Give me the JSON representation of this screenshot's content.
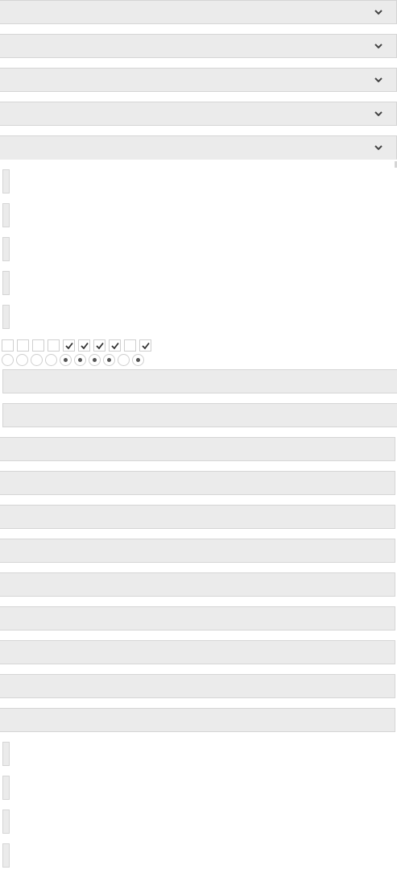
{
  "selects": [
    {
      "value": "",
      "expanded": false
    },
    {
      "value": "",
      "expanded": false
    },
    {
      "value": "",
      "expanded": false
    },
    {
      "value": "",
      "expanded": false
    },
    {
      "value": "",
      "expanded": true
    }
  ],
  "checkboxes": [
    false,
    false,
    false,
    false,
    true,
    true,
    true,
    true,
    false,
    true
  ],
  "radios": [
    false,
    false,
    false,
    false,
    true,
    true,
    true,
    true,
    false,
    true
  ],
  "inputs_wide": [
    "",
    ""
  ],
  "inputs_full": [
    "",
    "",
    "",
    "",
    "",
    "",
    "",
    "",
    ""
  ],
  "stubs_top": [
    "",
    "",
    "",
    "",
    ""
  ],
  "stubs_bottom": [
    "",
    "",
    "",
    ""
  ],
  "colors": {
    "field_bg": "#ebebeb",
    "border": "#d5d5d5",
    "check": "#333333",
    "radio_dot": "#555555"
  },
  "icons": {
    "select_arrow": "chevron-down-icon",
    "check": "check-icon"
  }
}
